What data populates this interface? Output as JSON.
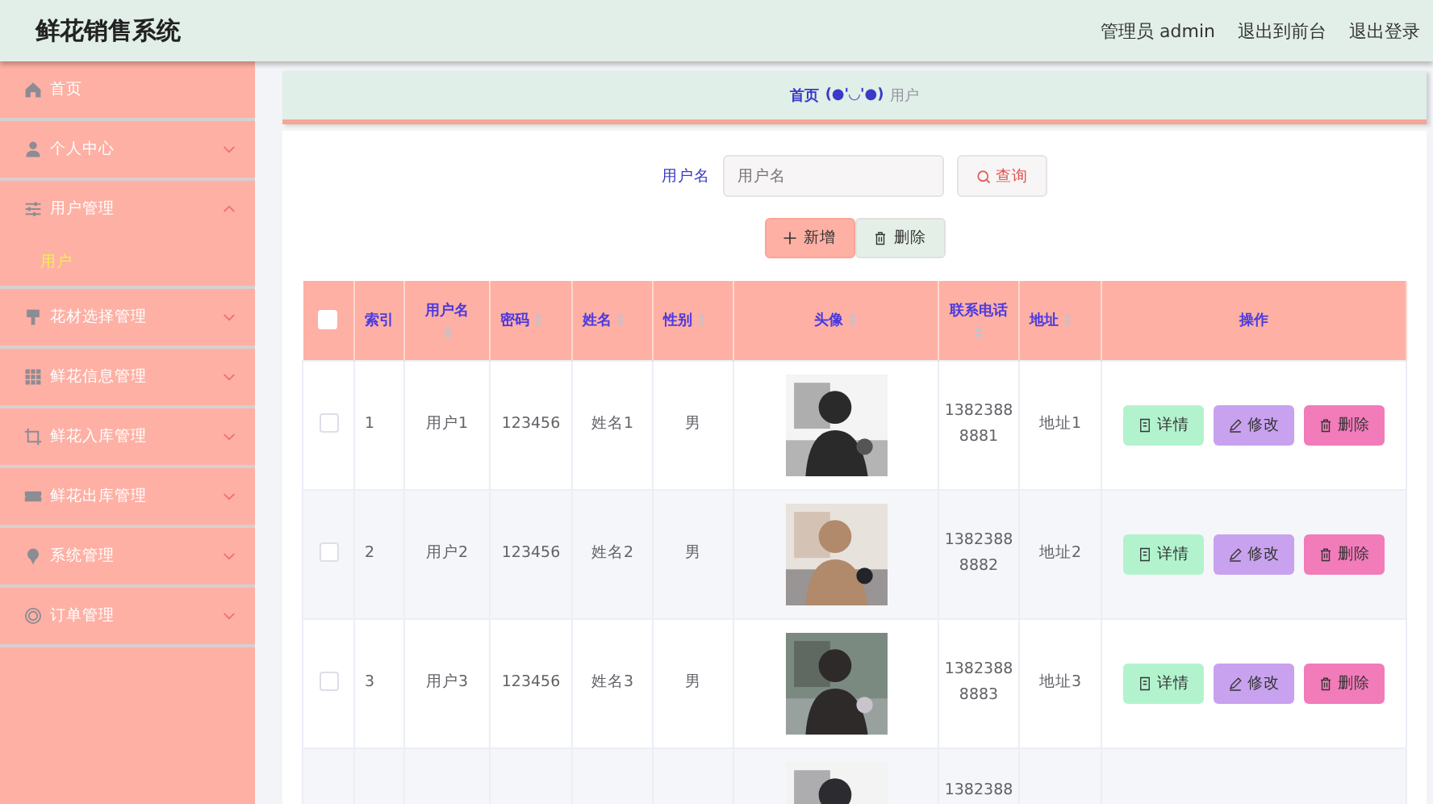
{
  "header": {
    "title": "鲜花销售系统",
    "links": [
      "管理员 admin",
      "退出到前台",
      "退出登录"
    ]
  },
  "sidebar": {
    "items": [
      {
        "label": "首页"
      },
      {
        "label": "个人中心",
        "expanded": false
      },
      {
        "label": "用户管理",
        "expanded": true,
        "children": [
          {
            "label": "用户",
            "selected": true
          }
        ]
      },
      {
        "label": "花材选择管理",
        "expanded": false
      },
      {
        "label": "鲜花信息管理",
        "expanded": false
      },
      {
        "label": "鲜花入库管理",
        "expanded": false
      },
      {
        "label": "鲜花出库管理",
        "expanded": false
      },
      {
        "label": "系统管理",
        "expanded": false
      },
      {
        "label": "订单管理",
        "expanded": false
      }
    ]
  },
  "breadcrumb": {
    "home": "首页",
    "separator": "(●'◡'●)",
    "current": "用户"
  },
  "search": {
    "label": "用户名",
    "placeholder": "用户名",
    "button": "查询"
  },
  "actions": {
    "add": "新增",
    "delete": "删除"
  },
  "table": {
    "select_all": {
      "checked": false
    },
    "columns": [
      {
        "label": "索引",
        "sortable": false
      },
      {
        "label": "用户名",
        "sortable": true,
        "wrap": true
      },
      {
        "label": "密码",
        "sortable": true,
        "wrap": false
      },
      {
        "label": "姓名",
        "sortable": true,
        "wrap": false
      },
      {
        "label": "性别",
        "sortable": true,
        "wrap": false
      },
      {
        "label": "头像",
        "sortable": true,
        "wrap": false
      },
      {
        "label": "联系电话",
        "sortable": true,
        "wrap": true
      },
      {
        "label": "地址",
        "sortable": true,
        "wrap": false
      },
      {
        "label": "操作",
        "sortable": false
      }
    ],
    "rows": [
      {
        "kind": "full",
        "checked": false,
        "index": "1",
        "username": "用户1",
        "password": "123456",
        "name": "姓名1",
        "gender": "男",
        "avatar": {
          "kind": "picture"
        },
        "phone": [
          "1382388",
          "8881"
        ],
        "address": "地址1",
        "buttons": [
          "详情",
          "修改",
          "删除"
        ]
      },
      {
        "kind": "full",
        "checked": false,
        "index": "2",
        "username": "用户2",
        "password": "123456",
        "name": "姓名2",
        "gender": "男",
        "avatar": {
          "kind": "picture"
        },
        "phone": [
          "1382388",
          "8882"
        ],
        "address": "地址2",
        "buttons": [
          "详情",
          "修改",
          "删除"
        ]
      },
      {
        "kind": "full",
        "checked": false,
        "index": "3",
        "username": "用户3",
        "password": "123456",
        "name": "姓名3",
        "gender": "男",
        "avatar": {
          "kind": "picture"
        },
        "phone": [
          "1382388",
          "8883"
        ],
        "address": "地址3",
        "buttons": [
          "详情",
          "修改",
          "删除"
        ]
      },
      {
        "kind": "partial",
        "avatar": {
          "kind": "picture"
        },
        "phone": [
          "1382388"
        ]
      }
    ]
  }
}
